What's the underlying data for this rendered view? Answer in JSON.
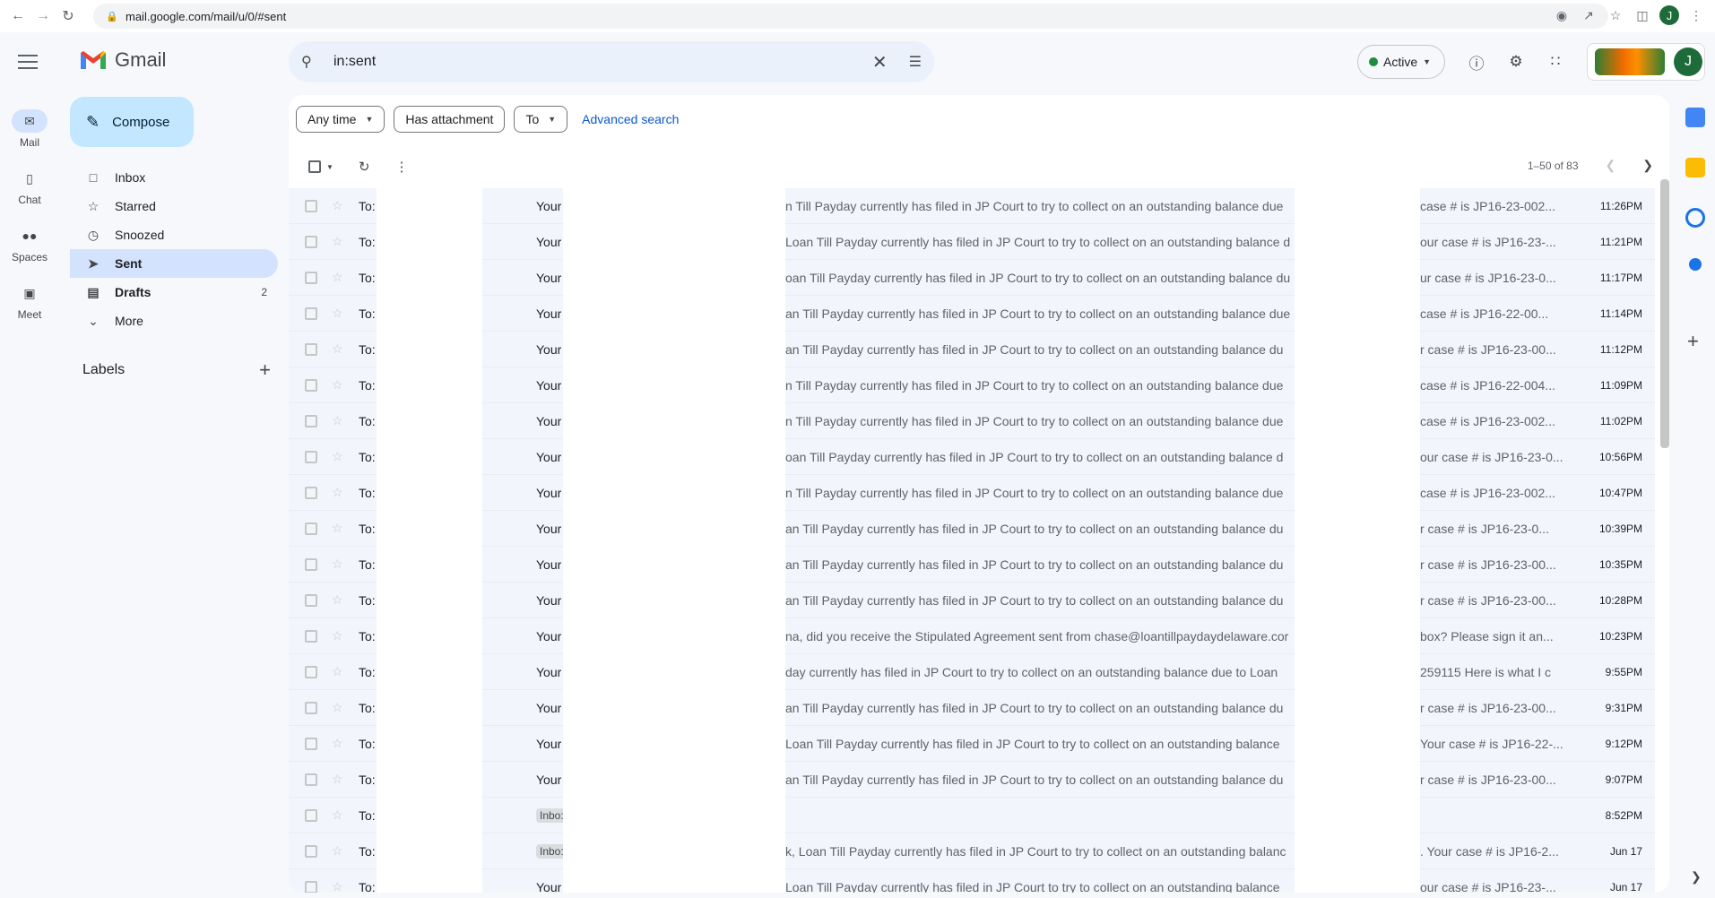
{
  "browser": {
    "url": "mail.google.com/mail/u/0/#sent",
    "profile_initial": "J"
  },
  "rail": {
    "items": [
      {
        "label": "Mail",
        "icon": "mail-icon"
      },
      {
        "label": "Chat",
        "icon": "chat-icon"
      },
      {
        "label": "Spaces",
        "icon": "spaces-icon"
      },
      {
        "label": "Meet",
        "icon": "meet-icon"
      }
    ]
  },
  "app": {
    "title": "Gmail"
  },
  "compose": {
    "label": "Compose"
  },
  "sidebar": {
    "items": [
      {
        "label": "Inbox",
        "icon": "inbox-icon",
        "count": ""
      },
      {
        "label": "Starred",
        "icon": "star-icon",
        "count": ""
      },
      {
        "label": "Snoozed",
        "icon": "clock-icon",
        "count": ""
      },
      {
        "label": "Sent",
        "icon": "send-icon",
        "count": ""
      },
      {
        "label": "Drafts",
        "icon": "draft-icon",
        "count": "2"
      },
      {
        "label": "More",
        "icon": "chevron-down-icon",
        "count": ""
      }
    ],
    "labels_heading": "Labels"
  },
  "search": {
    "value": "in:sent"
  },
  "header": {
    "status": "Active",
    "avatar_initial": "J"
  },
  "filters": {
    "any_time": "Any time",
    "has_attachment": "Has attachment",
    "to": "To",
    "advanced": "Advanced search"
  },
  "pager": {
    "range": "1–50 of 83"
  },
  "colors": {
    "accent": "#0b57d0",
    "compose_bg": "#c2e7ff",
    "active_nav": "#d3e3fd",
    "status_green": "#1e8e3e"
  },
  "emails": [
    {
      "to": "To:",
      "subject": "Your",
      "snippet": "n Till Payday currently has filed in JP Court to try to collect on an outstanding balance due",
      "snippet2": "case # is JP16-23-002...",
      "time": "11:26PM",
      "badge": ""
    },
    {
      "to": "To:",
      "subject": "Your",
      "snippet": "Loan Till Payday currently has filed in JP Court to try to collect on an outstanding balance d",
      "snippet2": "our case # is JP16-23-...",
      "time": "11:21PM",
      "badge": ""
    },
    {
      "to": "To:",
      "subject": "Your",
      "snippet": "oan Till Payday currently has filed in JP Court to try to collect on an outstanding balance du",
      "snippet2": "ur case # is JP16-23-0...",
      "time": "11:17PM",
      "badge": ""
    },
    {
      "to": "To:",
      "subject": "Your",
      "snippet": "an Till Payday currently has filed in JP Court to try to collect on an outstanding balance due",
      "snippet2": "case # is JP16-22-00...",
      "time": "11:14PM",
      "badge": ""
    },
    {
      "to": "To:",
      "subject": "Your",
      "snippet": "an Till Payday currently has filed in JP Court to try to collect on an outstanding balance du",
      "snippet2": "r case # is JP16-23-00...",
      "time": "11:12PM",
      "badge": ""
    },
    {
      "to": "To:",
      "subject": "Your",
      "snippet": "n Till Payday currently has filed in JP Court to try to collect on an outstanding balance due",
      "snippet2": "case # is JP16-22-004...",
      "time": "11:09PM",
      "badge": ""
    },
    {
      "to": "To:",
      "subject": "Your",
      "snippet": "n Till Payday currently has filed in JP Court to try to collect on an outstanding balance due",
      "snippet2": "case # is JP16-23-002...",
      "time": "11:02PM",
      "badge": ""
    },
    {
      "to": "To:",
      "subject": "Your",
      "snippet": "oan Till Payday currently has filed in JP Court to try to collect on an outstanding balance d",
      "snippet2": "our case # is JP16-23-0...",
      "time": "10:56PM",
      "badge": ""
    },
    {
      "to": "To:",
      "subject": "Your",
      "snippet": "n Till Payday currently has filed in JP Court to try to collect on an outstanding balance due",
      "snippet2": "case # is JP16-23-002...",
      "time": "10:47PM",
      "badge": ""
    },
    {
      "to": "To:",
      "subject": "Your",
      "snippet": "an Till Payday currently has filed in JP Court to try to collect on an outstanding balance du",
      "snippet2": "r case # is JP16-23-0...",
      "time": "10:39PM",
      "badge": ""
    },
    {
      "to": "To:",
      "subject": "Your",
      "snippet": "an Till Payday currently has filed in JP Court to try to collect on an outstanding balance du",
      "snippet2": "r case # is JP16-23-00...",
      "time": "10:35PM",
      "badge": ""
    },
    {
      "to": "To:",
      "subject": "Your",
      "snippet": "an Till Payday currently has filed in JP Court to try to collect on an outstanding balance du",
      "snippet2": "r case # is JP16-23-00...",
      "time": "10:28PM",
      "badge": ""
    },
    {
      "to": "To:",
      "subject": "Your",
      "snippet": "na, did you receive the Stipulated Agreement sent from chase@loantillpaydaydelaware.cor",
      "snippet2": "box? Please sign it an...",
      "time": "10:23PM",
      "badge": ""
    },
    {
      "to": "To:",
      "subject": "Your",
      "snippet": "day currently has filed in JP Court to try to collect on an outstanding balance due to Loan",
      "snippet2": "259115 Here is what I c",
      "time": "9:55PM",
      "badge": ""
    },
    {
      "to": "To:",
      "subject": "Your",
      "snippet": "an Till Payday currently has filed in JP Court to try to collect on an outstanding balance du",
      "snippet2": "r case # is JP16-23-00...",
      "time": "9:31PM",
      "badge": ""
    },
    {
      "to": "To:",
      "subject": "Your",
      "snippet": " Loan Till Payday currently has filed in JP Court to try to collect on an outstanding balance",
      "snippet2": "Your case # is JP16-22-...",
      "time": "9:12PM",
      "badge": ""
    },
    {
      "to": "To:",
      "subject": "Your",
      "snippet": "an Till Payday currently has filed in JP Court to try to collect on an outstanding balance du",
      "snippet2": "r case # is JP16-23-00...",
      "time": "9:07PM",
      "badge": ""
    },
    {
      "to": "To:",
      "subject": "",
      "snippet": "",
      "snippet2": "",
      "time": "8:52PM",
      "badge": "Inbo:"
    },
    {
      "to": "To:",
      "subject": "",
      "snippet": "k, Loan Till Payday currently has filed in JP Court to try to collect on an outstanding balanc",
      "snippet2": ". Your case # is JP16-2...",
      "time": "Jun 17",
      "badge": "Inbo:"
    },
    {
      "to": "To:",
      "subject": "Your",
      "snippet": "Loan Till Payday currently has filed in JP Court to try to collect on an outstanding balance",
      "snippet2": "our case # is JP16-23-...",
      "time": "Jun 17",
      "badge": ""
    }
  ]
}
